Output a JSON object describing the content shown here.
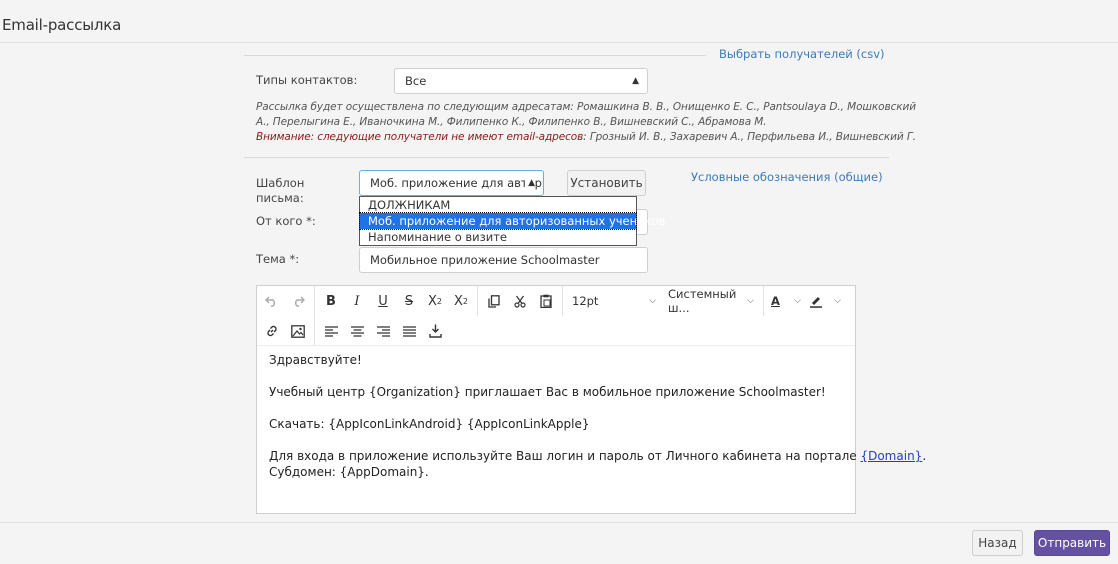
{
  "page": {
    "title": "Email-рассылка"
  },
  "recipients": {
    "choose_link": "Выбрать получателей (csv)",
    "contact_types_label": "Типы контактов:",
    "contact_types_value": "Все",
    "note_line1": "Рассылка будет осуществлена по следующим адресатам: Ромашкина В. В., Онищенко Е. С., Pantsoulaya D., Мошковский",
    "note_line2": "А., Перелыгина Е., Иваночкина М., Филипенко К., Филипенко В., Вишневский С., Абрамова М.",
    "warning_prefix": "Внимание: следующие получатели не имеют email-адресов:",
    "warning_names": " Грозный И. В., Захаревич А., Перфильева И., Вишневский Г."
  },
  "template": {
    "label_line1": "Шаблон",
    "label_line2": "письма:",
    "selected": "Моб. приложение для автори:",
    "set_button": "Установить",
    "legend_link": "Условные обозначения (общие)",
    "options": [
      "ДОЛЖНИКАМ",
      "Моб. приложение для авторизованных учеников",
      "Напоминание о визите"
    ],
    "selected_index": 1
  },
  "from": {
    "label": "От кого *:"
  },
  "subject": {
    "label": "Тема *:",
    "value": "Мобильное приложение Schoolmaster"
  },
  "editor": {
    "toolbar": {
      "font_size": "12pt",
      "font_family": "Системный ш..."
    },
    "body": {
      "greeting": "Здравствуйте!",
      "line2": "Учебный центр {Organization} приглашает Вас в мобильное приложение Schoolmaster!",
      "line3": "Скачать: {AppIconLinkAndroid}  {AppIconLinkApple}",
      "line4_text": "Для входа в приложение используйте Ваш логин и пароль от Личного кабинета на портале ",
      "line4_link": "{Domain}",
      "line4_end": ".",
      "line5": "Субдомен: {AppDomain}."
    }
  },
  "footer": {
    "back_button": "Назад",
    "send_button": "Отправить"
  },
  "colors": {
    "accent": "#6551a3",
    "link": "#3c7ab7",
    "warning": "#8a1a1a",
    "selection": "#1e73e6"
  }
}
